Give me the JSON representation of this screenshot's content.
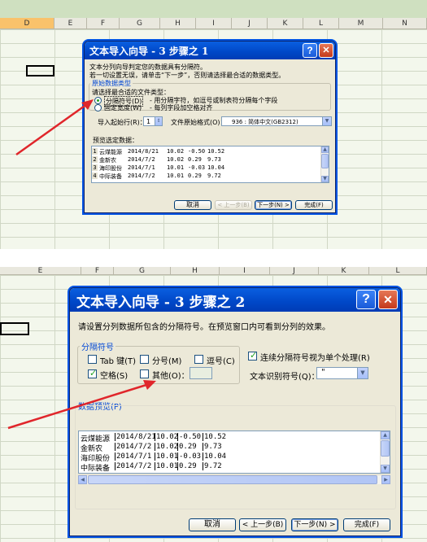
{
  "panel1": {
    "columns": [
      "D",
      "E",
      "F",
      "G",
      "H",
      "I",
      "J",
      "K",
      "L",
      "M",
      "N"
    ],
    "dialog": {
      "title": "文本导入向导 - 3 步骤之 1",
      "help_label": "?",
      "close_label": "✕",
      "intro_line1": "文本分列向导判定您的数据具有分隔符。",
      "intro_line2": "若一切设置无误，请单击“下一步”，否则请选择最合适的数据类型。",
      "group_label": "原始数据类型",
      "group_prompt": "请选择最合适的文件类型：",
      "radio_delimited": "分隔符号(D)",
      "radio_delimited_desc": "- 用分隔字符，如逗号或制表符分隔每个字段",
      "radio_fixed": "固定宽度(W)",
      "radio_fixed_desc": "- 每列字段加空格对齐",
      "start_row_label": "导入起始行(R)：",
      "start_row_value": "1",
      "origin_label": "文件原始格式(O)：",
      "origin_value": "936 : 简体中文(GB2312)",
      "preview_label": "预览选定数据：",
      "preview_rows": [
        {
          "num": "1",
          "c1": "云煤能源",
          "c2": "2014/8/21",
          "c3": "10.02",
          "c4": "-0.50",
          "c5": "10.52"
        },
        {
          "num": "2",
          "c1": "金新农",
          "c2": "2014/7/2",
          "c3": "10.02",
          "c4": "0.29",
          "c5": "9.73"
        },
        {
          "num": "3",
          "c1": "海印股份",
          "c2": "2014/7/1",
          "c3": "10.01",
          "c4": "-0.03",
          "c5": "10.04"
        },
        {
          "num": "4",
          "c1": "中际装备",
          "c2": "2014/7/2",
          "c3": "10.01",
          "c4": "0.29",
          "c5": "9.72"
        }
      ],
      "cancel": "取消",
      "back": "< 上一步(B)",
      "next": "下一步(N) >",
      "finish": "完成(F)"
    }
  },
  "panel2": {
    "columns": [
      "E",
      "F",
      "G",
      "H",
      "I",
      "J",
      "K",
      "L"
    ],
    "dialog": {
      "title": "文本导入向导 - 3 步骤之 2",
      "help_label": "?",
      "close_label": "✕",
      "intro": "请设置分列数据所包含的分隔符号。在预览窗口内可看到分列的效果。",
      "group_label": "分隔符号",
      "tab_label": "Tab 键(T)",
      "semicolon_label": "分号(M)",
      "comma_label": "逗号(C)",
      "space_label": "空格(S)",
      "other_label": "其他(O)：",
      "consecutive_label": "连续分隔符号视为单个处理(R)",
      "qualifier_label": "文本识别符号(Q)：",
      "qualifier_value": "\"",
      "preview_label": "数据预览(P)",
      "preview_rows": [
        {
          "c1": "云煤能源",
          "c2": "2014/8/21",
          "c3": "10.02",
          "c4": "-0.50",
          "c5": "10.52"
        },
        {
          "c1": "金新农",
          "c2": "2014/7/2",
          "c3": "10.02",
          "c4": "0.29",
          "c5": "9.73"
        },
        {
          "c1": "海印股份",
          "c2": "2014/7/1",
          "c3": "10.01",
          "c4": "-0.03",
          "c5": "10.04"
        },
        {
          "c1": "中际装备",
          "c2": "2014/7/2",
          "c3": "10.01",
          "c4": "0.29",
          "c5": "9.72"
        }
      ],
      "cancel": "取消",
      "back": "< 上一步(B)",
      "next": "下一步(N) >",
      "finish": "完成(F)"
    }
  },
  "colors": {
    "arrow": "#e0262b",
    "title_blue": "#0047c7",
    "dialog_bg": "#ece9d8"
  }
}
